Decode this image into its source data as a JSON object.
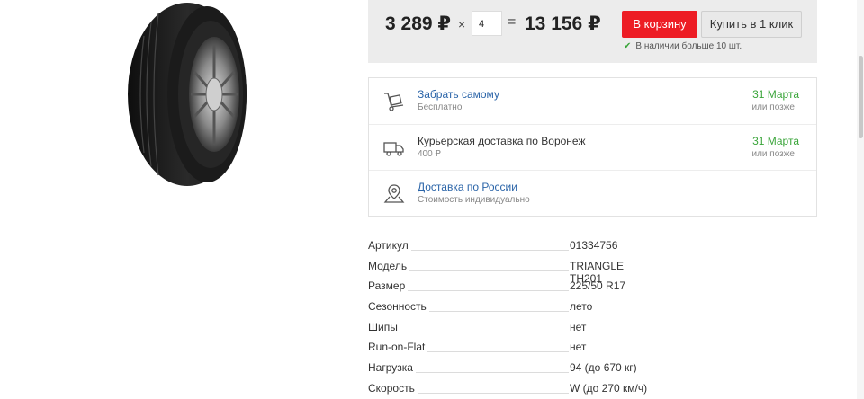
{
  "product": {
    "image_alt": "tire-image"
  },
  "price": {
    "unit_price": "3 289 ₽",
    "times": "×",
    "quantity": "4",
    "equals": "=",
    "total_price": "13 156 ₽",
    "add_to_cart": "В корзину",
    "buy_one_click": "Купить в 1 клик",
    "stock_status": "В наличии больше 10 шт."
  },
  "colors": {
    "accent_red": "#ed1c24",
    "link_blue": "#2a64a8",
    "date_green": "#3aa53a"
  },
  "delivery": [
    {
      "icon": "hand-truck-icon",
      "title": "Забрать самому",
      "subtitle": "Бесплатно",
      "date": "31 Марта",
      "date_note": "или позже"
    },
    {
      "icon": "delivery-truck-icon",
      "title": "Курьерская доставка по Воронеж",
      "subtitle": "400 ₽",
      "date": "31 Марта",
      "date_note": "или позже"
    },
    {
      "icon": "map-pin-icon",
      "title": "Доставка по России",
      "subtitle": "Стоимость индивидуально",
      "date": "",
      "date_note": ""
    }
  ],
  "specs": [
    {
      "key": "Артикул",
      "value": "01334756"
    },
    {
      "key": "Модель",
      "value": "TRIANGLE TH201"
    },
    {
      "key": "Размер",
      "value": "225/50 R17"
    },
    {
      "key": "Сезонность",
      "value": "лето"
    },
    {
      "key": "Шипы",
      "value": "нет"
    },
    {
      "key": "Run-on-Flat",
      "value": "нет"
    },
    {
      "key": "Нагрузка",
      "value": "94 (до 670 кг)"
    },
    {
      "key": "Скорость",
      "value": "W (до 270 км/ч)"
    }
  ]
}
